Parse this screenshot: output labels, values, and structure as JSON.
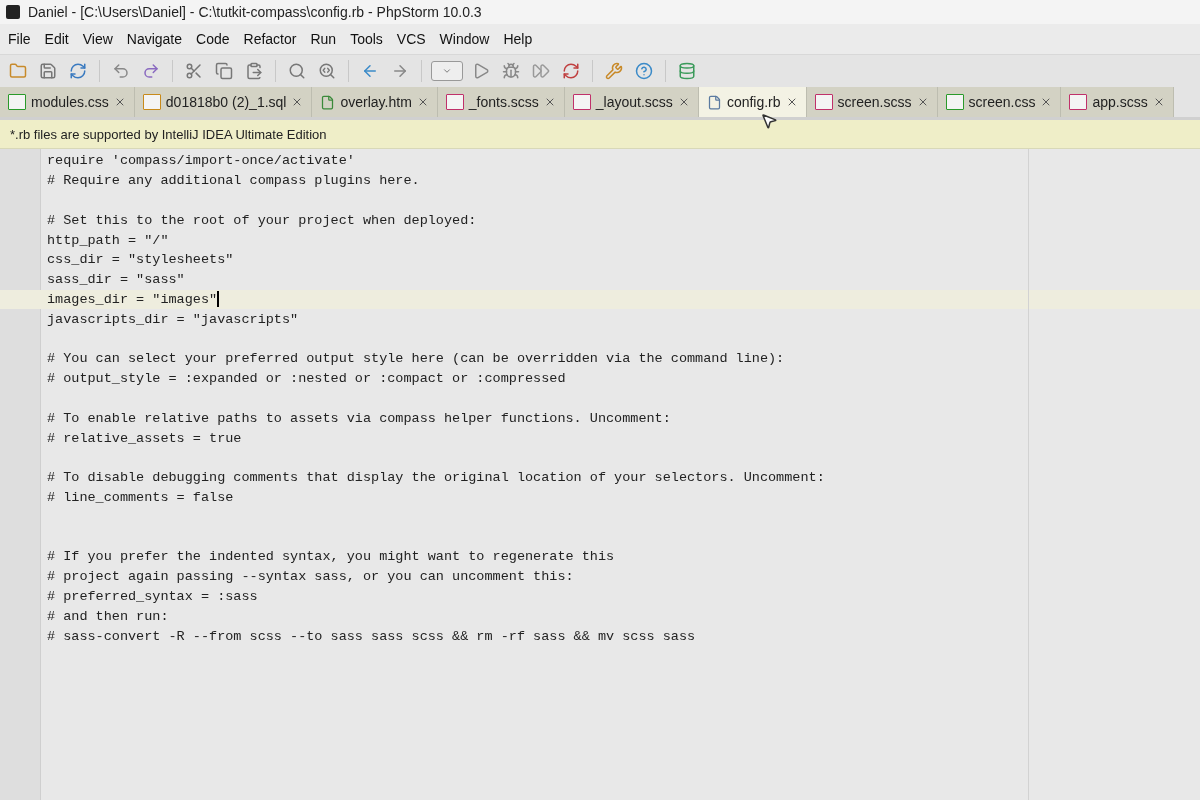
{
  "window": {
    "title": "Daniel - [C:\\Users\\Daniel] - C:\\tutkit-compass\\config.rb - PhpStorm 10.0.3"
  },
  "menu": [
    "File",
    "Edit",
    "View",
    "Navigate",
    "Code",
    "Refactor",
    "Run",
    "Tools",
    "VCS",
    "Window",
    "Help"
  ],
  "tabs": [
    {
      "label": "modules.css",
      "kind": "css",
      "selected": false
    },
    {
      "label": "d01818b0 (2)_1.sql",
      "kind": "sql",
      "selected": false
    },
    {
      "label": "overlay.htm",
      "kind": "htm",
      "selected": false
    },
    {
      "label": "_fonts.scss",
      "kind": "sass",
      "selected": false
    },
    {
      "label": "_layout.scss",
      "kind": "sass",
      "selected": false
    },
    {
      "label": "config.rb",
      "kind": "rb",
      "selected": true
    },
    {
      "label": "screen.scss",
      "kind": "sass",
      "selected": false
    },
    {
      "label": "screen.css",
      "kind": "css",
      "selected": false
    },
    {
      "label": "app.scss",
      "kind": "sass",
      "selected": false
    }
  ],
  "notification": "*.rb files are supported by IntelliJ IDEA Ultimate Edition",
  "editor": {
    "lines": [
      {
        "kind": "code",
        "text": "require 'compass/import-once/activate'",
        "current": false
      },
      {
        "kind": "code",
        "text": "# Require any additional compass plugins here.",
        "current": false
      },
      {
        "kind": "blank",
        "current": false
      },
      {
        "kind": "code",
        "text": "# Set this to the root of your project when deployed:",
        "current": false
      },
      {
        "kind": "code",
        "text": "http_path = \"/\"",
        "current": false
      },
      {
        "kind": "code",
        "text": "css_dir = \"stylesheets\"",
        "current": false
      },
      {
        "kind": "code",
        "text": "sass_dir = \"sass\"",
        "current": false
      },
      {
        "kind": "code",
        "text": "images_dir = \"images\"",
        "current": true
      },
      {
        "kind": "code",
        "text": "javascripts_dir = \"javascripts\"",
        "current": false
      },
      {
        "kind": "blank",
        "current": false
      },
      {
        "kind": "code",
        "text": "# You can select your preferred output style here (can be overridden via the command line):",
        "current": false
      },
      {
        "kind": "code",
        "text": "# output_style = :expanded or :nested or :compact or :compressed",
        "current": false
      },
      {
        "kind": "blank",
        "current": false
      },
      {
        "kind": "code",
        "text": "# To enable relative paths to assets via compass helper functions. Uncomment:",
        "current": false
      },
      {
        "kind": "code",
        "text": "# relative_assets = true",
        "current": false
      },
      {
        "kind": "blank",
        "current": false
      },
      {
        "kind": "code",
        "text": "# To disable debugging comments that display the original location of your selectors. Uncomment:",
        "current": false
      },
      {
        "kind": "code",
        "text": "# line_comments = false",
        "current": false
      },
      {
        "kind": "blank",
        "current": false
      },
      {
        "kind": "blank",
        "current": false
      },
      {
        "kind": "code",
        "text": "# If you prefer the indented syntax, you might want to regenerate this",
        "current": false
      },
      {
        "kind": "code",
        "text": "# project again passing --syntax sass, or you can uncomment this:",
        "current": false
      },
      {
        "kind": "code",
        "text": "# preferred_syntax = :sass",
        "current": false
      },
      {
        "kind": "code",
        "text": "# and then run:",
        "current": false
      },
      {
        "kind": "code",
        "text": "# sass-convert -R --from scss --to sass sass scss && rm -rf sass && mv scss sass",
        "current": false
      }
    ]
  }
}
